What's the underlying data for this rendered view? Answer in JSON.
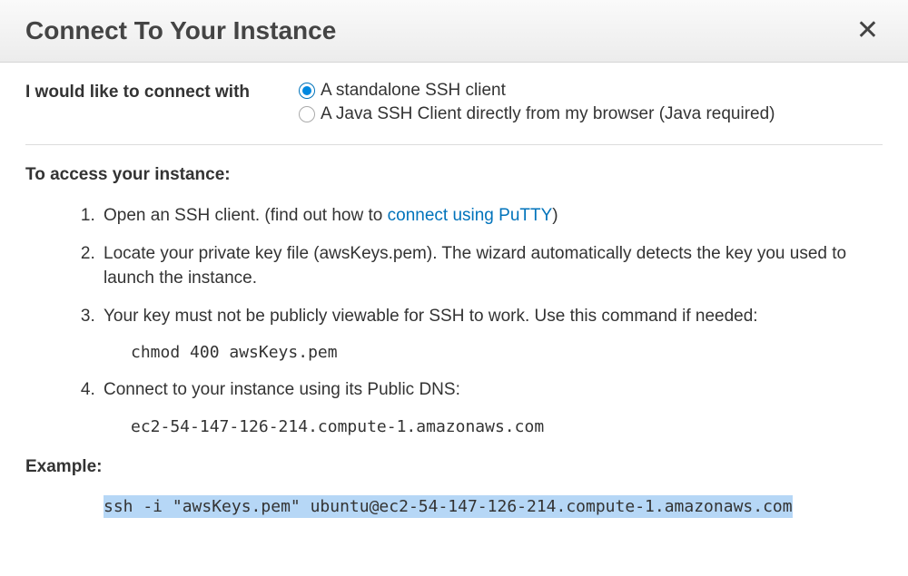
{
  "header": {
    "title": "Connect To Your Instance"
  },
  "connect": {
    "label": "I would like to connect with",
    "options": [
      {
        "label": "A standalone SSH client",
        "selected": true
      },
      {
        "label": "A Java SSH Client directly from my browser (Java required)",
        "selected": false
      }
    ]
  },
  "access": {
    "title": "To access your instance:",
    "steps": {
      "s1_prefix": "Open an SSH client. (find out how to ",
      "s1_link": "connect using PuTTY",
      "s1_suffix": ")",
      "s2": "Locate your private key file (awsKeys.pem). The wizard automatically detects the key you used to launch the instance.",
      "s3": "Your key must not be publicly viewable for SSH to work. Use this command if needed:",
      "s3_code": "chmod 400 awsKeys.pem",
      "s4": "Connect to your instance using its Public DNS:",
      "s4_code": "ec2-54-147-126-214.compute-1.amazonaws.com"
    }
  },
  "example": {
    "label": "Example:",
    "code": "ssh -i \"awsKeys.pem\" ubuntu@ec2-54-147-126-214.compute-1.amazonaws.com"
  }
}
